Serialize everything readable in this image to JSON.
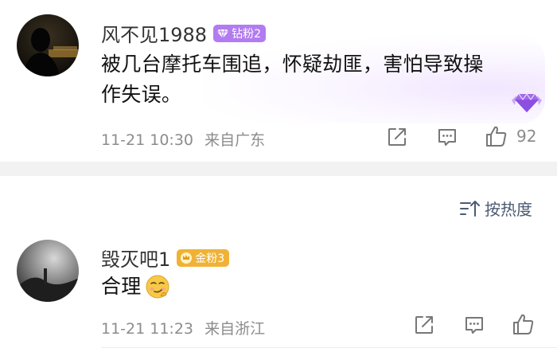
{
  "comments": [
    {
      "username": "风不见1988",
      "badge": {
        "label": "钻粉2",
        "color": "#b27cf0",
        "icon": "diamond-icon"
      },
      "text_line1": "被几台摩托车围追，怀疑劫匪，害怕导致操",
      "text_line2": "作失误。",
      "time": "11-21 10:30",
      "location": "来自广东",
      "likes": "92"
    },
    {
      "username": "毁灭吧1",
      "badge": {
        "label": "金粉3",
        "color": "#f0b236",
        "icon": "crown-icon"
      },
      "text": "合理",
      "emoji": "smirk-emoji",
      "time": "11-21 11:23",
      "location": "来自浙江"
    }
  ],
  "sort_label": "按热度",
  "colors": {
    "meta": "#8c8c8c",
    "divider": "#f2f2f2",
    "sort": "#4b5a73"
  }
}
